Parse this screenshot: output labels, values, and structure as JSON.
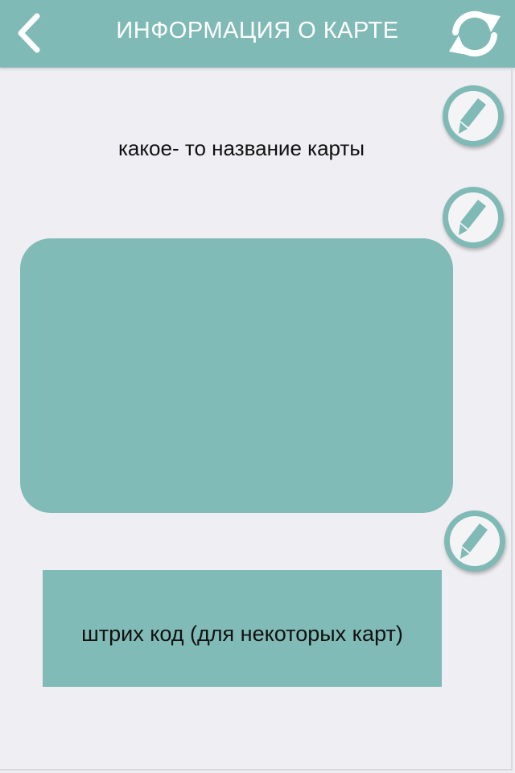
{
  "header": {
    "title": "ИНФОРМАЦИЯ О КАРТЕ",
    "back_icon": "chevron-left-icon",
    "refresh_icon": "refresh-icon",
    "background": "#80bab6"
  },
  "card": {
    "name": "какое- то название карты",
    "image_color": "#81bbb7"
  },
  "barcode": {
    "label": "штрих код (для некоторых карт)"
  },
  "edit_buttons": {
    "icon": "pencil-icon"
  }
}
